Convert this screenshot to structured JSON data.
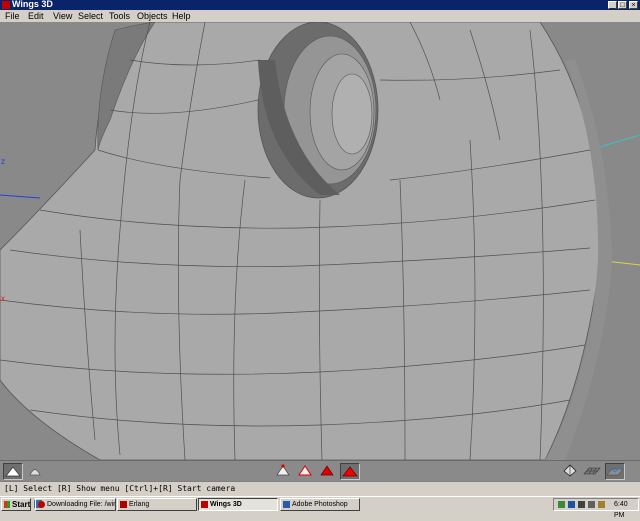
{
  "window": {
    "title": "Wings 3D",
    "minimize_glyph": "_",
    "maximize_glyph": "□",
    "close_glyph": "×"
  },
  "menu": [
    "File",
    "Edit",
    "View",
    "Select",
    "Tools",
    "Objects",
    "Help"
  ],
  "viewport": {
    "axis_labels": {
      "z": "z",
      "x": "x"
    },
    "axis_colors": {
      "x": "#e02020",
      "y": "#20c020",
      "z": "#2040e0",
      "neg_x": "#d8d840",
      "neg_z": "#40c0c0"
    },
    "mesh_color": "#a9a9a9",
    "background": "#898989"
  },
  "toolbar": {
    "left": [
      "smooth-shading-icon",
      "wireframe-shading-icon"
    ],
    "selection_modes": [
      "vertex-mode-icon",
      "edge-mode-icon",
      "face-mode-icon",
      "object-mode-icon"
    ],
    "active_mode": "object",
    "right": [
      "perspective-icon",
      "groundplane-icon",
      "axes-icon"
    ]
  },
  "status": {
    "text": "[L] Select  [R] Show menu  [Ctrl]+[R] Start camera"
  },
  "taskbar": {
    "start_label": "Start",
    "tasks": [
      {
        "label": "Downloading File: /wings/..."
      },
      {
        "label": "Erlang"
      },
      {
        "label": "Wings 3D"
      },
      {
        "label": "Adobe Photoshop"
      }
    ],
    "active_task": "Wings 3D",
    "clock": "6:40 PM"
  }
}
